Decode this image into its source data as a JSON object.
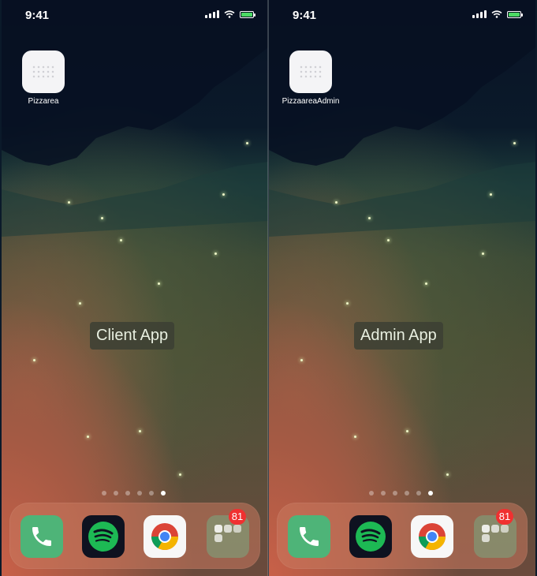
{
  "colors": {
    "accent_green": "#4eb478",
    "badge_red": "#f03030",
    "battery_green": "#4bd964"
  },
  "left": {
    "status": {
      "time": "9:41"
    },
    "app": {
      "label": "Pizzarea",
      "icon": "app-placeholder-icon"
    },
    "center_label": "Client App",
    "page_dots": {
      "count": 6,
      "active_index": 5
    },
    "dock": {
      "phone": {
        "icon": "phone-icon"
      },
      "spotify": {
        "icon": "spotify-icon"
      },
      "chrome": {
        "icon": "chrome-icon"
      },
      "folder": {
        "icon": "folder-icon",
        "badge": "81"
      }
    }
  },
  "right": {
    "status": {
      "time": "9:41"
    },
    "app": {
      "label": "PizzaareaAdmin",
      "icon": "app-placeholder-icon"
    },
    "center_label": "Admin App",
    "page_dots": {
      "count": 6,
      "active_index": 5
    },
    "dock": {
      "phone": {
        "icon": "phone-icon"
      },
      "spotify": {
        "icon": "spotify-icon"
      },
      "chrome": {
        "icon": "chrome-icon"
      },
      "folder": {
        "icon": "folder-icon",
        "badge": "81"
      }
    }
  }
}
